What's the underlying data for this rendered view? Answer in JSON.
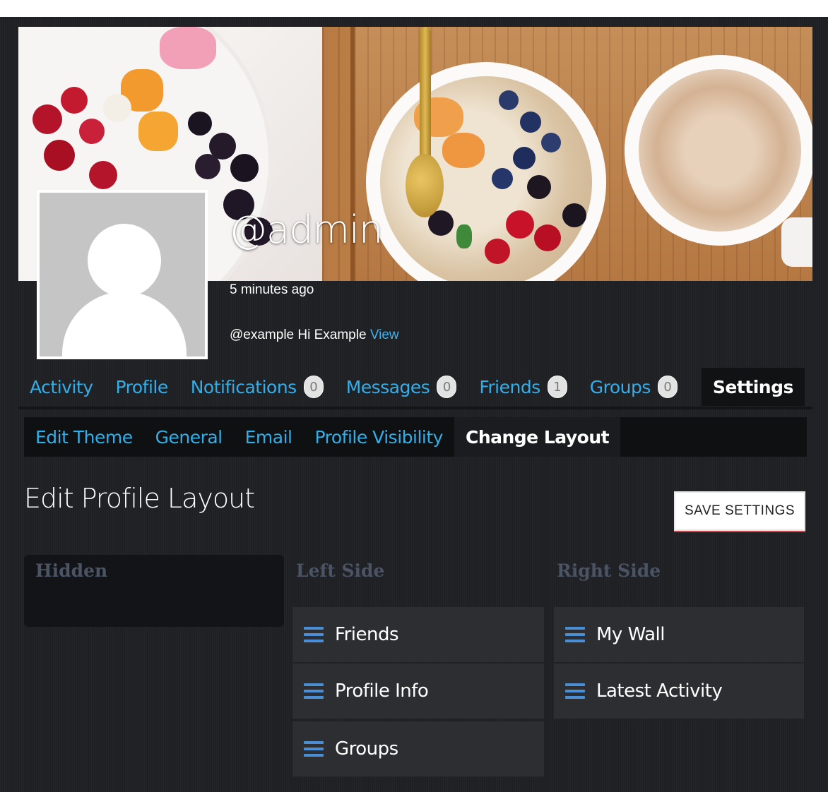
{
  "profile": {
    "username": "@admin",
    "last_active": "5 minutes ago",
    "status_text": "@example Hi Example",
    "status_link": "View"
  },
  "nav": {
    "items": [
      {
        "label": "Activity"
      },
      {
        "label": "Profile"
      },
      {
        "label": "Notifications",
        "count": "0"
      },
      {
        "label": "Messages",
        "count": "0"
      },
      {
        "label": "Friends",
        "count": "1"
      },
      {
        "label": "Groups",
        "count": "0"
      },
      {
        "label": "Settings",
        "active": true
      }
    ]
  },
  "subnav": {
    "items": [
      {
        "label": "Edit Theme"
      },
      {
        "label": "General"
      },
      {
        "label": "Email"
      },
      {
        "label": "Profile Visibility"
      },
      {
        "label": "Change Layout",
        "active": true
      }
    ]
  },
  "page": {
    "title": "Edit Profile Layout",
    "save_label": "SAVE SETTINGS"
  },
  "columns": {
    "hidden": {
      "title": "Hidden",
      "items": []
    },
    "left": {
      "title": "Left Side",
      "items": [
        "Friends",
        "Profile Info",
        "Groups"
      ]
    },
    "right": {
      "title": "Right Side",
      "items": [
        "My Wall",
        "Latest Activity"
      ]
    }
  },
  "colors": {
    "accent": "#33aee8",
    "background": "#1f2023",
    "item_bg": "#2d2e31",
    "drag_icon": "#4a8fd6"
  },
  "icons": {
    "drag_handle": "drag-handle-icon",
    "avatar": "default-avatar-icon"
  }
}
